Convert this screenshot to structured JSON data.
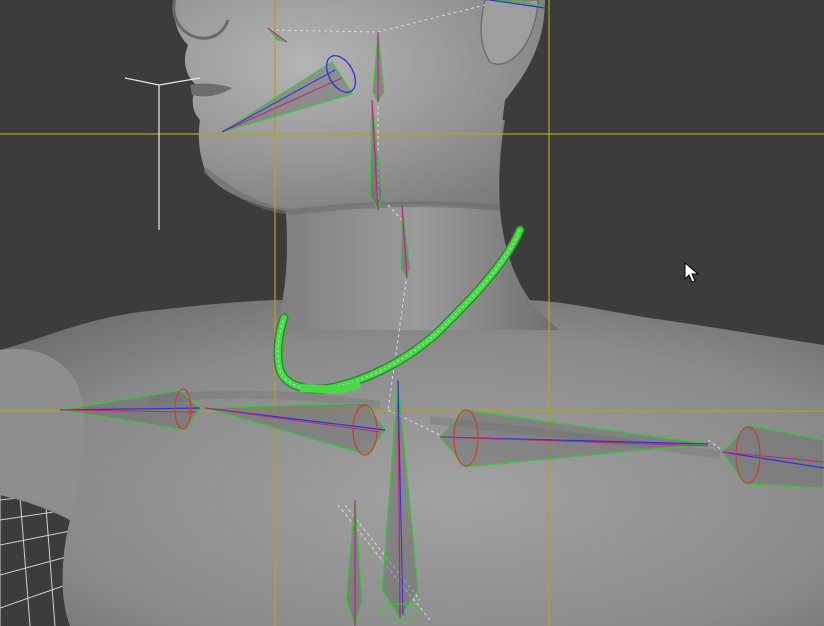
{
  "viewport": {
    "background": "#3c3c3c",
    "figure_shade": "#8a8a8a",
    "guide_color": "#b3a21a",
    "bone_outline_color": "#3cc63c",
    "bone_axis_color": "#2a35d8",
    "bone_core_color": "#c0257e",
    "selection_color": "#4bd94b",
    "grid_color": "#d0d0d0",
    "cursor_icon": "arrow-cursor-icon"
  }
}
